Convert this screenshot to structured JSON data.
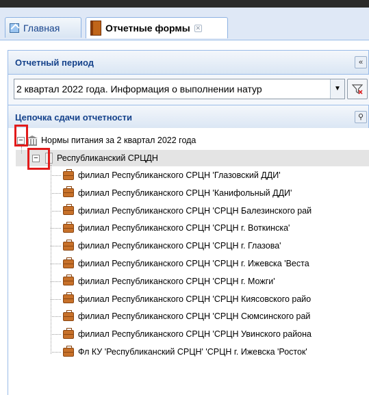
{
  "tabs": [
    {
      "label": "Главная",
      "icon": "home-icon",
      "active": false
    },
    {
      "label": "Отчетные формы",
      "icon": "forms-book-icon",
      "active": true
    }
  ],
  "period_panel": {
    "title": "Отчетный период",
    "selected_value": "2 квартал 2022 года. Информация о выполнении натур"
  },
  "chain_panel": {
    "title": "Цепочка сдачи отчетности"
  },
  "tree": {
    "root": "Нормы питания за 2 квартал 2022 года",
    "level1": "Республиканский СРЦДН",
    "children": [
      "филиал Республиканского СРЦН 'Глазовский ДДИ'",
      "филиал Республиканского СРЦН 'Канифольный ДДИ'",
      "филиал Республиканского СРЦН 'СРЦН Балезинского рай",
      "филиал Республиканского СРЦН 'СРЦН г. Воткинска'",
      "филиал Республиканского СРЦН 'СРЦН г. Глазова'",
      "филиал Республиканского СРЦН 'СРЦН г. Ижевска 'Веста",
      "филиал Республиканского СРЦН 'СРЦН г. Можги'",
      "филиал Республиканского СРЦН 'СРЦН Киясовского райо",
      "филиал Республиканского СРЦН 'СРЦН Сюмсинского рай",
      "филиал Республиканского СРЦН 'СРЦН Увинского района",
      "Фл КУ 'Республиканский СРЦН' 'СРЦН г. Ижевска 'Росток'"
    ]
  },
  "colors": {
    "highlight": "#e21b1b",
    "header_text": "#15428b",
    "panel_border": "#99bbe8"
  }
}
